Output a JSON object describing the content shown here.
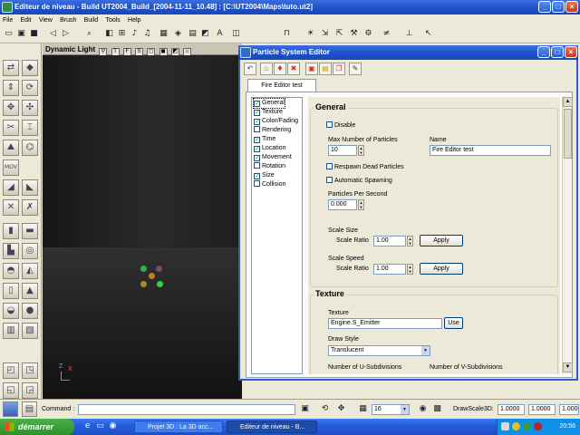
{
  "window": {
    "title": "Editeur de niveau - Build UT2004_Build_[2004-11-11_10.48] : [C:\\UT2004\\Maps\\tuto.ut2]"
  },
  "menu": [
    "File",
    "Edit",
    "View",
    "Brush",
    "Build",
    "Tools",
    "Help"
  ],
  "viewport": {
    "label": "Dynamic Light",
    "view_buttons": [
      "T",
      "F",
      "S"
    ],
    "axis": {
      "z": "Z",
      "x": "X"
    }
  },
  "particle_editor": {
    "title": "Particle System Editor",
    "tab": "Fire Editor test",
    "categories": [
      {
        "label": "General",
        "checked": true
      },
      {
        "label": "Texture",
        "checked": true
      },
      {
        "label": "Color/Fading",
        "checked": true
      },
      {
        "label": "Rendering",
        "checked": false
      },
      {
        "label": "Time",
        "checked": true
      },
      {
        "label": "Location",
        "checked": true
      },
      {
        "label": "Movement",
        "checked": true
      },
      {
        "label": "Rotation",
        "checked": false
      },
      {
        "label": "Size",
        "checked": true
      },
      {
        "label": "Collision",
        "checked": false
      }
    ],
    "general": {
      "heading": "General",
      "disable_label": "Disable",
      "max_particles_label": "Max Number of Particles",
      "max_particles_value": "10",
      "name_label": "Name",
      "name_value": "Fire Editor test",
      "respawn_label": "Respawn Dead Particles",
      "auto_spawn_label": "Automatic Spawning",
      "pps_label": "Particles Per Second",
      "pps_value": "0.000",
      "scale_size_label": "Scale Size",
      "scale_speed_label": "Scale Speed",
      "scale_ratio_label": "Scale Ratio",
      "scale_size_value": "1.00",
      "scale_speed_value": "1.00",
      "apply_label": "Apply"
    },
    "texture": {
      "heading": "Texture",
      "texture_label": "Texture",
      "texture_value": "Engine.S_Emitter",
      "use_label": "Use",
      "draw_style_label": "Draw Style",
      "draw_style_value": "Translucent",
      "u_sub_label": "Number of U-Subdivisions",
      "v_sub_label": "Number of V-Subdivisions"
    }
  },
  "bottom": {
    "command_label": "Command :",
    "grid_value": "16",
    "drawscale_label": "DrawScale3D:",
    "drawscale_x": "1.0000",
    "drawscale_y": "1.0000",
    "drawscale_z": "1.0000"
  },
  "taskbar": {
    "start_label": "démarrer",
    "tasks": [
      "Projet 3D : La 3D acc...",
      "Editeur de niveau - B..."
    ],
    "clock": "20:56"
  }
}
